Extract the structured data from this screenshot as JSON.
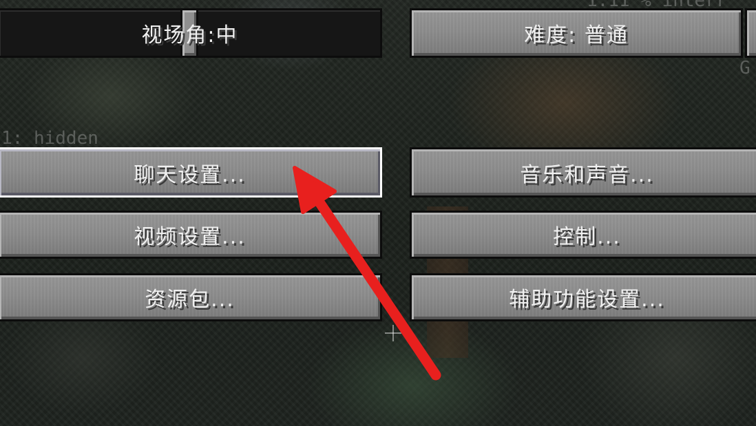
{
  "background": {
    "debug_left": "1: hidden",
    "debug_top": "1.11 % interr",
    "debug_right": "G"
  },
  "options": {
    "fov_label": "视场角:中",
    "difficulty_label": "难度: 普通",
    "chat_label": "聊天设置...",
    "music_label": "音乐和声音...",
    "video_label": "视频设置...",
    "controls_label": "控制...",
    "resource_label": "资源包...",
    "accessibility_label": "辅助功能设置..."
  },
  "colors": {
    "button_face": "#8d8d8d",
    "button_hover_border": "#ffffff",
    "label_text": "#f0f0f0",
    "arrow": "#e8201e"
  },
  "icons": {
    "annotation": "red-arrow-pointing-to-chat-settings"
  }
}
